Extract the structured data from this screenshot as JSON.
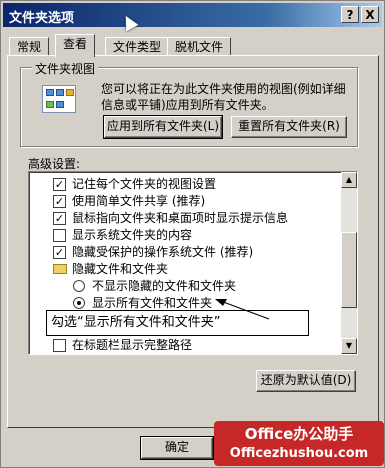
{
  "window": {
    "title": "文件夹选项",
    "help_button": "?",
    "close_button": "X"
  },
  "tabs": [
    {
      "label": "常规"
    },
    {
      "label": "查看"
    },
    {
      "label": "文件类型"
    },
    {
      "label": "脱机文件"
    }
  ],
  "folder_view": {
    "group_title": "文件夹视图",
    "description": "您可以将正在为此文件夹使用的视图(例如详细信息或平铺)应用到所有文件夹。",
    "apply_all_button": "应用到所有文件夹(L)",
    "reset_all_button": "重置所有文件夹(R)"
  },
  "advanced": {
    "label": "高级设置:",
    "items": [
      {
        "type": "checkbox",
        "checked": true,
        "label": "记住每个文件夹的视图设置"
      },
      {
        "type": "checkbox",
        "checked": true,
        "label": "使用简单文件共享 (推荐)"
      },
      {
        "type": "checkbox",
        "checked": true,
        "label": "鼠标指向文件夹和桌面项时显示提示信息"
      },
      {
        "type": "checkbox",
        "checked": false,
        "label": "显示系统文件夹的内容"
      },
      {
        "type": "checkbox",
        "checked": true,
        "label": "隐藏受保护的操作系统文件 (推荐)"
      },
      {
        "type": "folder",
        "label": "隐藏文件和文件夹"
      },
      {
        "type": "radio",
        "checked": false,
        "label": "不显示隐藏的文件和文件夹"
      },
      {
        "type": "radio",
        "checked": true,
        "label": "显示所有文件和文件夹"
      },
      {
        "type": "hidden",
        "label": ""
      },
      {
        "type": "checkbox",
        "checked": false,
        "label": "在标题栏显示完整路径"
      }
    ],
    "restore_defaults_button": "还原为默认值(D)"
  },
  "callout": {
    "text": "勾选“显示所有文件和文件夹”"
  },
  "footer": {
    "ok_button": "确定"
  },
  "watermark": {
    "line1": "Office办公助手",
    "line2": "Officezhushou.com"
  }
}
